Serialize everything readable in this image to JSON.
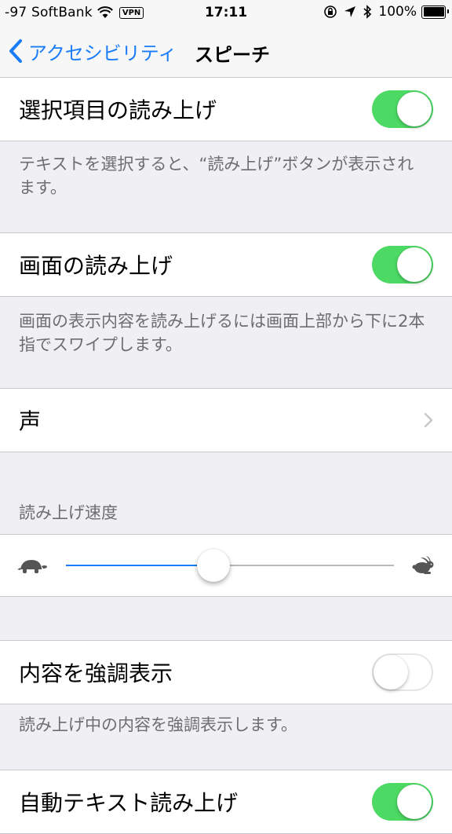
{
  "status_bar": {
    "carrier": "-97 SoftBank",
    "vpn": "VPN",
    "time": "17:11",
    "battery": "100%"
  },
  "nav": {
    "back_label": "アクセシビリティ",
    "title": "スピーチ"
  },
  "speak_selection": {
    "label": "選択項目の読み上げ",
    "on": true,
    "footer": "テキストを選択すると、“読み上げ”ボタンが表示されます。"
  },
  "speak_screen": {
    "label": "画面の読み上げ",
    "on": true,
    "footer": "画面の表示内容を読み上げるには画面上部から下に2本指でスワイプします。"
  },
  "voices": {
    "label": "声"
  },
  "speaking_rate": {
    "header": "読み上げ速度",
    "value_fraction": 0.45
  },
  "highlight_content": {
    "label": "内容を強調表示",
    "on": false,
    "footer": "読み上げ中の内容を強調表示します。"
  },
  "auto_text": {
    "label": "自動テキスト読み上げ",
    "on": true
  },
  "colors": {
    "accent": "#1a7cf6",
    "switch_on": "#4cd964",
    "background": "#efeff4"
  }
}
